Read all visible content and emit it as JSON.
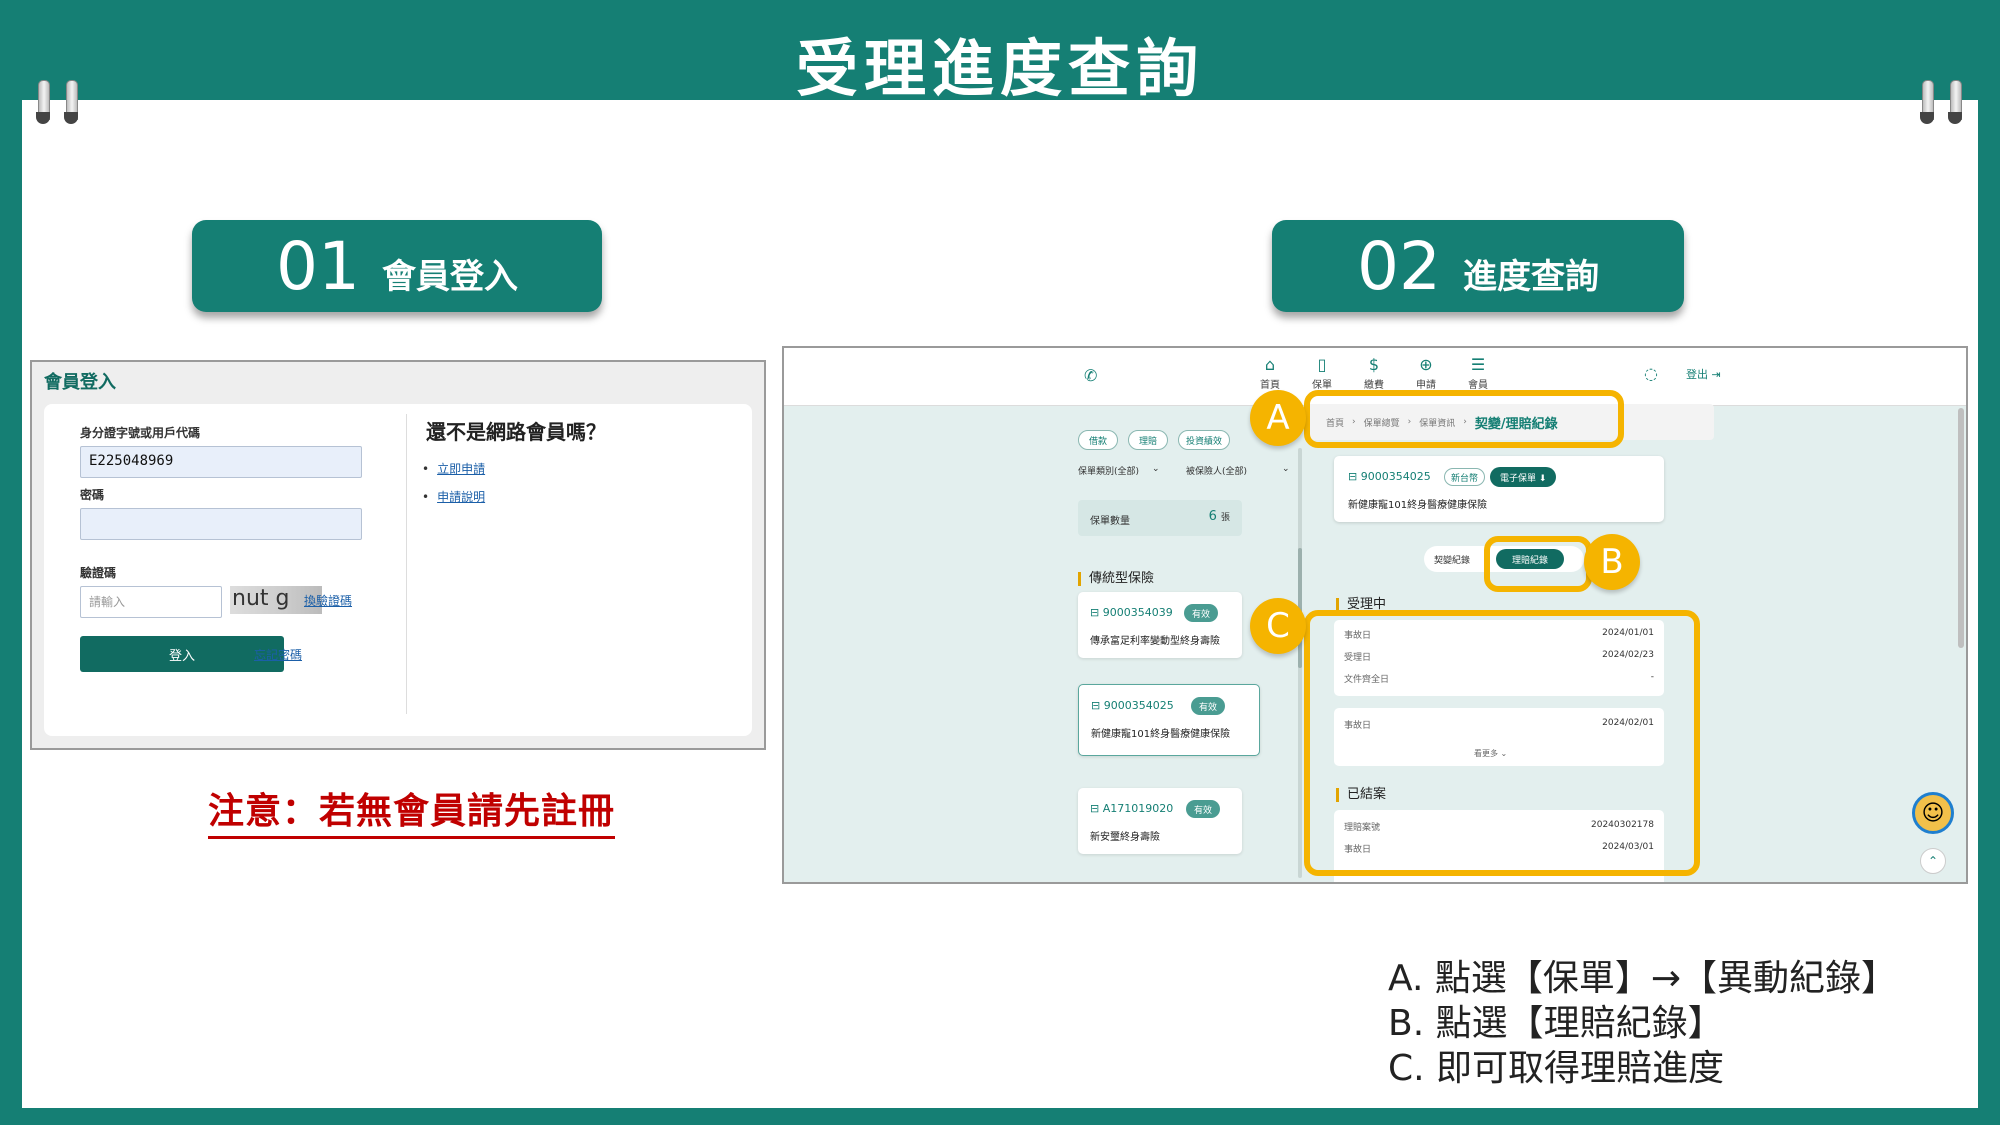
{
  "title": "受理進度查詢",
  "steps": [
    {
      "num": "01",
      "label": "會員登入"
    },
    {
      "num": "02",
      "label": "進度查詢"
    }
  ],
  "login": {
    "panel_title": "會員登入",
    "id_label": "身分證字號或用戶代碼",
    "id_value": "E225048969",
    "password_label": "密碼",
    "captcha_label": "驗證碼",
    "captcha_placeholder": "請輸入",
    "captcha_text": "nut g",
    "refresh_captcha": "換驗證碼",
    "login_button": "登入",
    "forgot_password": "忘記密碼",
    "nonmember_title": "還不是網路會員嗎？",
    "apply_now": "立即申請",
    "apply_guide": "申請說明"
  },
  "notice": "注意：若無會員請先註冊",
  "app": {
    "nav": [
      {
        "icon": "⌂",
        "label": "首頁"
      },
      {
        "icon": "▯",
        "label": "保單"
      },
      {
        "icon": "$",
        "label": "繳費"
      },
      {
        "icon": "⊕",
        "label": "申請"
      },
      {
        "icon": "☰",
        "label": "會員"
      }
    ],
    "logout": "登出 ⇥",
    "filter_chips": [
      "借款",
      "理賠",
      "投資績效"
    ],
    "filter_selects": [
      "保單類別(全部)",
      "被保險人(全部)"
    ],
    "policy_count_label": "保單數量",
    "policy_count_value": "6",
    "policy_count_unit": "張",
    "section_traditional": "傳統型保險",
    "policies": [
      {
        "no": "9000354039",
        "status": "有效",
        "name": "傳承富足利率變動型終身壽險"
      },
      {
        "no": "9000354025",
        "status": "有效",
        "name": "新健康寵101終身醫療健康保險"
      },
      {
        "no": "A171019020",
        "status": "有效",
        "name": "新安璽終身壽險"
      }
    ],
    "breadcrumb": [
      "首頁",
      "保單總覽",
      "保單資訊"
    ],
    "breadcrumb_current": "契變/理賠紀錄",
    "detail": {
      "no": "9000354025",
      "currency": "新台幣",
      "e_policy": "電子保單 ⬇",
      "name": "新健康寵101終身醫療健康保險"
    },
    "toggle": {
      "change": "契變紀錄",
      "claim": "理賠紀錄"
    },
    "section_processing": "受理中",
    "processing_rows": [
      {
        "label": "事故日",
        "value": "2024/01/01"
      },
      {
        "label": "受理日",
        "value": "2024/02/23"
      },
      {
        "label": "文件齊全日",
        "value": "-"
      }
    ],
    "processing_rows2": [
      {
        "label": "事故日",
        "value": "2024/02/01"
      }
    ],
    "see_more": "看更多 ⌄",
    "section_closed": "已結案",
    "closed_rows": [
      {
        "label": "理賠案號",
        "value": "20240302178"
      },
      {
        "label": "事故日",
        "value": "2024/03/01"
      }
    ],
    "markers": [
      "A",
      "B",
      "C"
    ]
  },
  "instructions": [
    "A.  點選【保單】→【異動紀錄】",
    "B.  點選【理賠紀錄】",
    "C.  即可取得理賠進度"
  ],
  "colors": {
    "brand": "#157f74",
    "highlight": "#f5b400",
    "notice": "#c00000"
  }
}
